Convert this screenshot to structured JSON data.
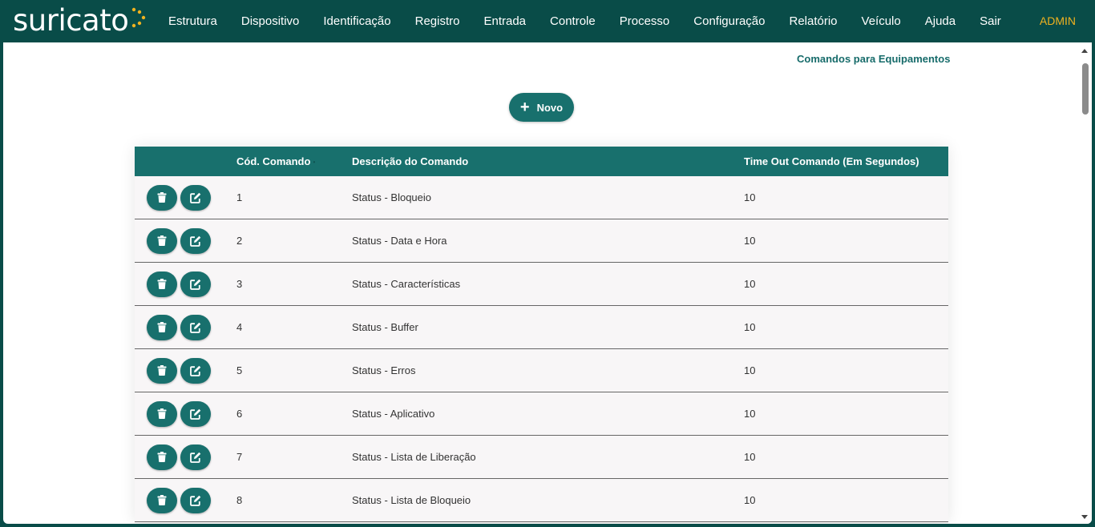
{
  "app": {
    "logo_text": "suricato",
    "user": "ADMIN"
  },
  "nav": {
    "items": [
      {
        "label": "Estrutura"
      },
      {
        "label": "Dispositivo"
      },
      {
        "label": "Identificação"
      },
      {
        "label": "Registro"
      },
      {
        "label": "Entrada"
      },
      {
        "label": "Controle"
      },
      {
        "label": "Processo"
      },
      {
        "label": "Configuração"
      },
      {
        "label": "Relatório"
      },
      {
        "label": "Veículo"
      },
      {
        "label": "Ajuda"
      },
      {
        "label": "Sair"
      }
    ]
  },
  "page": {
    "title": "Comandos para Equipamentos",
    "new_button": "Novo"
  },
  "table": {
    "columns": [
      "",
      "Cód. Comando",
      "Descrição do Comando",
      "Time Out Comando (Em Segundos)"
    ],
    "rows": [
      {
        "cod": "1",
        "desc": "Status - Bloqueio",
        "timeout": "10"
      },
      {
        "cod": "2",
        "desc": "Status - Data e Hora",
        "timeout": "10"
      },
      {
        "cod": "3",
        "desc": "Status - Características",
        "timeout": "10"
      },
      {
        "cod": "4",
        "desc": "Status - Buffer",
        "timeout": "10"
      },
      {
        "cod": "5",
        "desc": "Status - Erros",
        "timeout": "10"
      },
      {
        "cod": "6",
        "desc": "Status - Aplicativo",
        "timeout": "10"
      },
      {
        "cod": "7",
        "desc": "Status - Lista de Liberação",
        "timeout": "10"
      },
      {
        "cod": "8",
        "desc": "Status - Lista de Bloqueio",
        "timeout": "10"
      }
    ]
  },
  "icons": {
    "delete": "trash-icon",
    "edit": "edit-icon",
    "add": "plus-icon"
  },
  "colors": {
    "header_bg": "#094c48",
    "accent": "#18706d",
    "user_label": "#f0b21f",
    "row_bg": "#f8f6f7"
  }
}
